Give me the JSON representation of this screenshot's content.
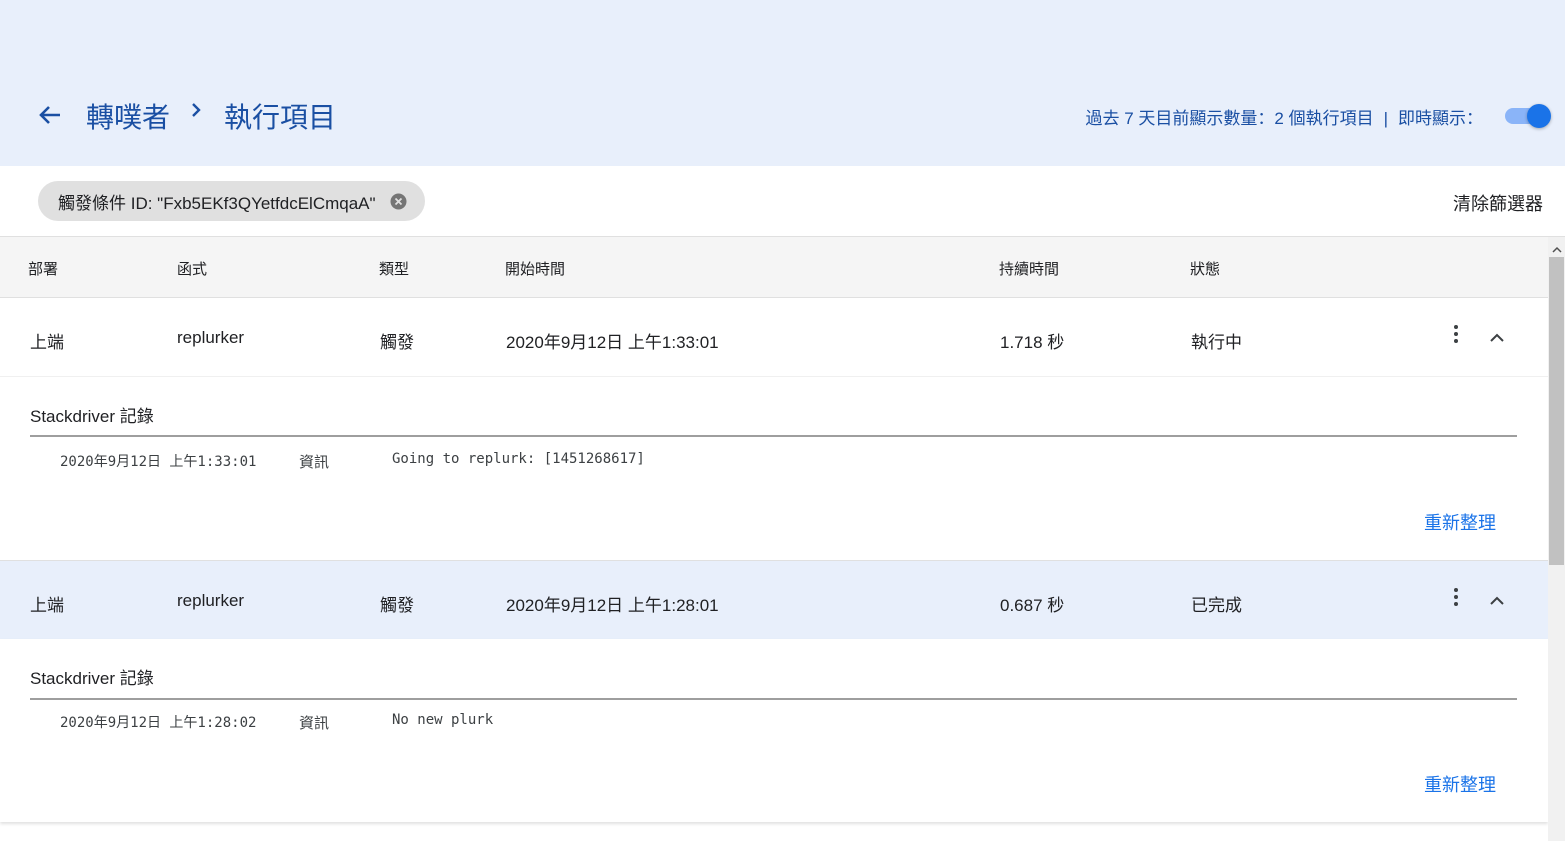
{
  "header": {
    "breadcrumb_root": "轉噗者",
    "breadcrumb_current": "執行項目",
    "summary": "過去 7 天目前顯示數量：2 個執行項目",
    "separator": "|",
    "realtime_label": "即時顯示：",
    "realtime_on": true
  },
  "filter": {
    "chip_label": "觸發條件 ID: \"Fxb5EKf3QYetfdcElCmqaA\"",
    "clear_label": "清除篩選器"
  },
  "table": {
    "columns": [
      "部署",
      "函式",
      "類型",
      "開始時間",
      "持續時間",
      "狀態"
    ],
    "rows": [
      {
        "deployment": "上端",
        "function": "replurker",
        "type": "觸發",
        "start": "2020年9月12日 上午1:33:01",
        "duration": "1.718 秒",
        "status": "執行中",
        "log_title": "Stackdriver 記錄",
        "log": {
          "time": "2020年9月12日 上午1:33:01",
          "level": "資訊",
          "message": "Going to replurk: [1451268617]"
        },
        "refresh_label": "重新整理"
      },
      {
        "deployment": "上端",
        "function": "replurker",
        "type": "觸發",
        "start": "2020年9月12日 上午1:28:01",
        "duration": "0.687 秒",
        "status": "已完成",
        "log_title": "Stackdriver 記錄",
        "log": {
          "time": "2020年9月12日 上午1:28:02",
          "level": "資訊",
          "message": "No new plurk"
        },
        "refresh_label": "重新整理"
      }
    ]
  },
  "colors": {
    "header_bg": "#e8effb",
    "accent": "#1a73e8",
    "title_blue": "#1a4fa3",
    "selected_row": "#e8effb"
  }
}
